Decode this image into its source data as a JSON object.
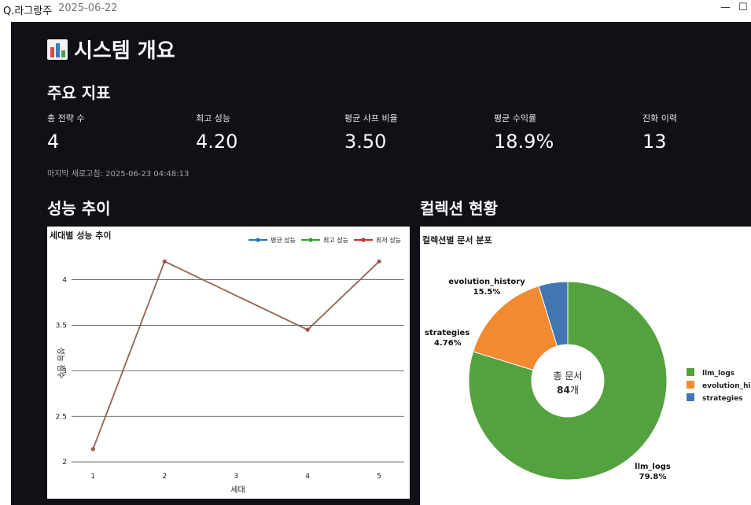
{
  "window": {
    "title": "Q.라그랑주",
    "date": "2025-06-22",
    "minimize_glyph": "—",
    "maximize_glyph": "☐"
  },
  "page": {
    "title": "시스템 개요",
    "title_icon": "bar-chart-icon"
  },
  "metrics_section": {
    "title": "주요 지표",
    "items": [
      {
        "label": "총 전략 수",
        "value": "4"
      },
      {
        "label": "최고 성능",
        "value": "4.20"
      },
      {
        "label": "평균 샤프 비율",
        "value": "3.50"
      },
      {
        "label": "평균 수익률",
        "value": "18.9%"
      },
      {
        "label": "진화 이력",
        "value": "13"
      }
    ],
    "refresh_caption": "마지막 새로고침: 2025-06-23 04:48:13"
  },
  "performance_section": {
    "title": "성능 추이"
  },
  "collection_section": {
    "title": "컬렉션 현황"
  },
  "chart_data": [
    {
      "type": "line",
      "title": "세대별 성능 추이",
      "xlabel": "세대",
      "ylabel": "성능 점수",
      "x": [
        1,
        2,
        3,
        4,
        5
      ],
      "xlim": [
        0.7,
        5.35
      ],
      "ylim": [
        1.95,
        4.22
      ],
      "yticks": [
        2,
        2.5,
        3,
        3.5,
        4
      ],
      "ytick_labels": [
        "2",
        "2.5",
        "3",
        "3.5",
        "4"
      ],
      "grid": "horizontal",
      "legend_position": "top-right",
      "series": [
        {
          "name": "평균 성능",
          "color": "#1f77b4",
          "x": [
            1,
            2,
            4,
            5
          ],
          "values": [
            2.14,
            4.2,
            3.45,
            4.2
          ]
        },
        {
          "name": "최고 성능",
          "color": "#2ca02c",
          "x": [
            1,
            2,
            4,
            5
          ],
          "values": [
            2.14,
            4.2,
            3.45,
            4.2
          ]
        },
        {
          "name": "최저 성능",
          "color": "#d62728",
          "x": [
            1,
            2,
            4,
            5
          ],
          "values": [
            2.14,
            4.2,
            3.45,
            4.2
          ]
        }
      ]
    },
    {
      "type": "pie",
      "title": "컬렉션별 문서 분포",
      "center_label": "총 문서",
      "center_value": "84",
      "center_unit": "개",
      "slices": [
        {
          "label": "llm_logs",
          "percent_label": "79.8%",
          "value": 79.8,
          "color": "#54a13f"
        },
        {
          "label": "evolution_history",
          "percent_label": "15.5%",
          "value": 15.5,
          "color": "#f18a30"
        },
        {
          "label": "strategies",
          "percent_label": "4.76%",
          "value": 4.76,
          "color": "#4176b3"
        }
      ],
      "legend": [
        "llm_logs",
        "evolution_hi",
        "strategies"
      ],
      "legend_position": "right"
    }
  ]
}
